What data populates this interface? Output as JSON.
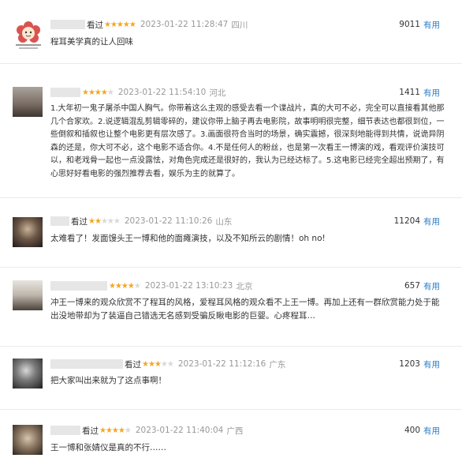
{
  "comments": [
    {
      "seen": "看过",
      "stars": 5,
      "date": "2023-01-22 11:28:47",
      "location": "四川",
      "votes": "9011",
      "useful": "有用",
      "text": "程耳美学真的让人回味"
    },
    {
      "seen": "",
      "stars": 4,
      "date": "2023-01-22 11:54:10",
      "location": "河北",
      "votes": "1411",
      "useful": "有用",
      "text": "1.大年初一鬼子屠杀中国人胸气。你带着这么主观的感受去看一个谍战片，真的大可不必，完全可以直接看其他那几个合家欢。2.说逻辑混乱剪辑零碎的，建议你带上脑子再去电影院，故事明明很完整，细节表达也都很到位，一些倒叙和插叙也让整个电影更有层次感了。3.画面很符合当时的场景，确实震撼，很深刻地能得到共情，说诡异阴森的还是，你大可不必，这个电影不适合你。4.不是任何人的粉丝，也是第一次看王一博演的戏，看观评价演技可以，和老戏骨一起也一点没露怯，对角色完成还是很好的，我认为已经达标了。5.这电影已经完全超出预期了，有心思好好看电影的强烈推荐去看，娱乐为主的就算了。"
    },
    {
      "seen": "看过",
      "stars": 2,
      "date": "2023-01-22 11:10:26",
      "location": "山东",
      "votes": "11204",
      "useful": "有用",
      "text": "太难看了！发面馒头王一博和他的面瘫演技，以及不知所云的剧情！oh no!"
    },
    {
      "seen": "",
      "stars": 4,
      "date": "2023-01-22 13:10:23",
      "location": "北京",
      "votes": "657",
      "useful": "有用",
      "text": "冲王一博来的观众欣赏不了程耳的风格，爱程耳风格的观众看不上王一博。再加上还有一群欣赏能力处于能出没地带却为了装逼自己错选无名感到受骗反瞅电影的巨婴。心疼程耳…"
    },
    {
      "seen": "看过",
      "stars": 3,
      "date": "2023-01-22 11:12:16",
      "location": "广东",
      "votes": "1203",
      "useful": "有用",
      "text": "把大家叫出来就为了这点事啊！"
    },
    {
      "seen": "看过",
      "stars": 4,
      "date": "2023-01-22 11:40:04",
      "location": "广西",
      "votes": "400",
      "useful": "有用",
      "text": "王一博和张婧仪是真的不行……"
    }
  ]
}
